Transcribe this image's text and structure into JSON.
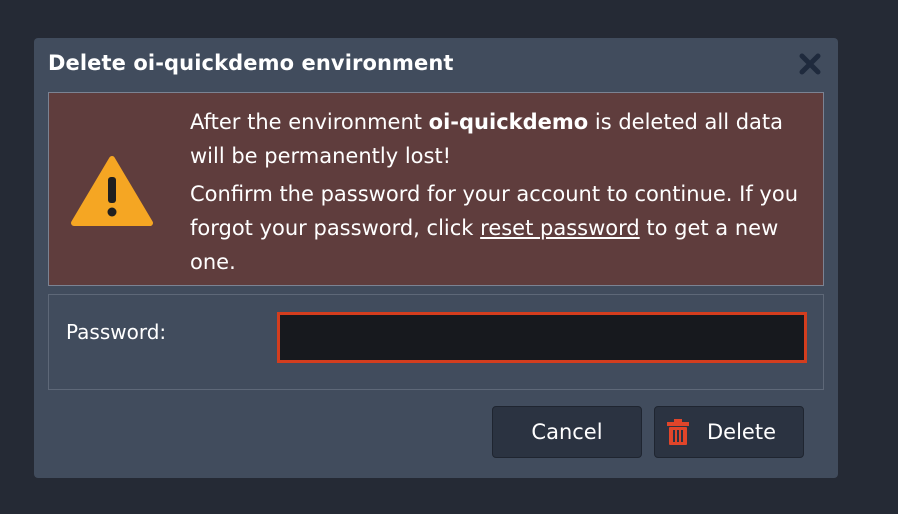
{
  "dialog": {
    "title": "Delete oi-quickdemo environment",
    "close_icon": "close-icon",
    "warning": {
      "icon": "warning-icon",
      "line1_prefix": "After the environment ",
      "env_name": "oi-quickdemo",
      "line1_suffix": " is deleted all data will be permanently lost!",
      "line2_prefix": "Confirm the password for your account to continue. If you forgot your password, click ",
      "reset_link": "reset password",
      "line2_suffix": " to get a new one."
    },
    "form": {
      "password_label": "Password:",
      "password_value": ""
    },
    "buttons": {
      "cancel_label": "Cancel",
      "delete_label": "Delete",
      "delete_icon": "trash-icon"
    }
  },
  "colors": {
    "page_bg": "#252a35",
    "dialog_bg": "#414c5d",
    "warning_bg": "#5f3d3d",
    "warning_icon": "#f5a623",
    "input_border": "#d33d1e",
    "delete_icon": "#e0452a",
    "close_icon": "#1f2a3d"
  }
}
